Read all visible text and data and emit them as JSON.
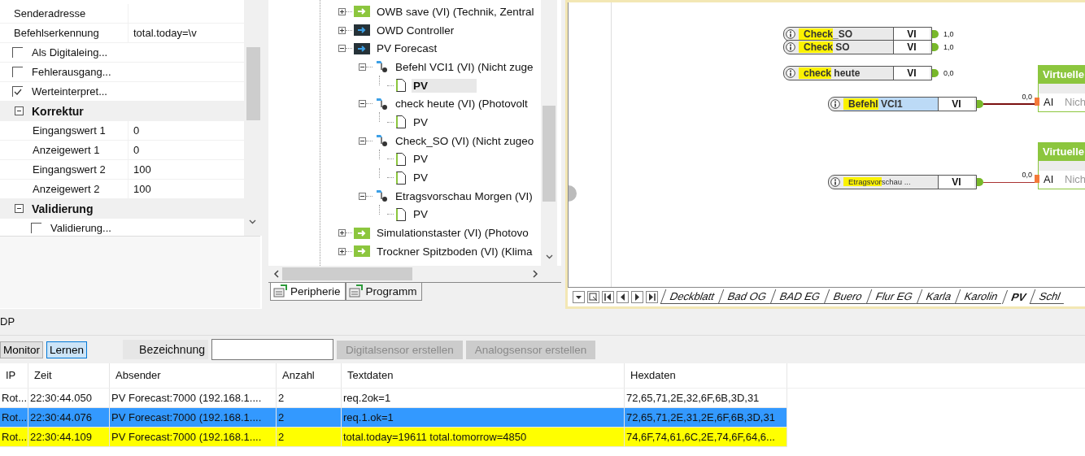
{
  "properties": [
    {
      "kind": "field",
      "name": "Senderadresse"
    },
    {
      "kind": "field",
      "name": "Befehlserkennung",
      "value": "total.today=\\v"
    },
    {
      "kind": "check",
      "name": "Als Digitaleing...",
      "checked": false
    },
    {
      "kind": "check",
      "name": "Fehlerausgang...",
      "checked": false
    },
    {
      "kind": "check",
      "name": "Werteinterpret...",
      "checked": true
    },
    {
      "kind": "category",
      "name": "Korrektur",
      "expanded": true
    },
    {
      "kind": "sub",
      "name": "Eingangswert 1",
      "value": "0"
    },
    {
      "kind": "sub",
      "name": "Anzeigewert 1",
      "value": "0"
    },
    {
      "kind": "sub",
      "name": "Eingangswert 2",
      "value": "100"
    },
    {
      "kind": "sub",
      "name": "Anzeigewert 2",
      "value": "100"
    },
    {
      "kind": "category",
      "name": "Validierung",
      "expanded": true
    },
    {
      "kind": "subcheck",
      "name": "Validierung...",
      "checked": false
    }
  ],
  "tree": [
    {
      "kind": "device",
      "label": "OWB save (VI) (Technik, Zentral",
      "color": "#8cc63e",
      "expanded": false,
      "selected": false
    },
    {
      "kind": "device",
      "label": "OWD Controller",
      "color": "#263238",
      "expanded": false,
      "selected": false
    },
    {
      "kind": "device",
      "label": "PV Forecast",
      "color": "#263238",
      "expanded": true,
      "selected": false,
      "children": [
        {
          "kind": "vi",
          "label": "Befehl VCI1 (VI) (Nicht zuge",
          "expanded": true,
          "selected": false,
          "children": [
            {
              "kind": "doc",
              "label": "PV",
              "selected": true
            }
          ]
        },
        {
          "kind": "vi",
          "label": "check heute (VI) (Photovolt",
          "expanded": true,
          "selected": false,
          "children": [
            {
              "kind": "doc",
              "label": "PV",
              "selected": false
            }
          ]
        },
        {
          "kind": "vi",
          "label": "Check_SO (VI) (Nicht zugeo",
          "expanded": true,
          "selected": false,
          "children": [
            {
              "kind": "doc",
              "label": "PV",
              "selected": false
            },
            {
              "kind": "doc",
              "label": "PV",
              "selected": false
            }
          ]
        },
        {
          "kind": "vi",
          "label": "Etragsvorschau Morgen (VI)",
          "expanded": true,
          "selected": false,
          "children": [
            {
              "kind": "doc",
              "label": "PV",
              "selected": false
            }
          ]
        }
      ]
    },
    {
      "kind": "device",
      "label": "Simulationstaster (VI) (Photovo",
      "color": "#8cc63e",
      "expanded": false,
      "selected": false
    },
    {
      "kind": "device",
      "label": "Trockner Spitzboden (VI) (Klima",
      "color": "#8cc63e",
      "expanded": false,
      "selected": false
    }
  ],
  "panel_tabs": [
    {
      "label": "Peripherie",
      "selected": true
    },
    {
      "label": "Programm",
      "selected": false
    }
  ],
  "canvas": {
    "nodes": [
      {
        "match": "Check",
        "rest": "_SO",
        "type": "VI",
        "value": "1,0",
        "selected": false,
        "small": false
      },
      {
        "match": "Check",
        "rest": " SO",
        "type": "VI",
        "value": "1,0",
        "selected": false,
        "small": false
      },
      {
        "match": "check",
        "rest": " heute",
        "type": "VI",
        "value": "0,0",
        "selected": false,
        "small": false
      },
      {
        "match": "Befehl",
        "rest": " VCI1",
        "type": "VI",
        "value": "0,0",
        "selected": true,
        "small": false,
        "linked": true
      },
      {
        "match": "Etragsvor",
        "rest": "schau ...",
        "type": "VI",
        "value": "0,0",
        "selected": false,
        "small": true,
        "linked": true
      }
    ],
    "blocks": [
      {
        "title": "Virtuelle",
        "port": "AI",
        "label": "Nich"
      },
      {
        "title": "Virtuelle",
        "port": "AI",
        "label": "Nich"
      }
    ]
  },
  "sheet_tabs": [
    {
      "label": "Deckblatt",
      "selected": false
    },
    {
      "label": "Bad OG",
      "selected": false
    },
    {
      "label": "BAD EG",
      "selected": false
    },
    {
      "label": "Buero",
      "selected": false
    },
    {
      "label": "Flur EG",
      "selected": false
    },
    {
      "label": "Karla",
      "selected": false
    },
    {
      "label": "Karolin",
      "selected": false
    },
    {
      "label": "PV",
      "selected": true
    },
    {
      "label": "Schl",
      "selected": false
    }
  ],
  "udp": {
    "title": "DP",
    "modes": [
      {
        "label": "Monitor",
        "selected": false
      },
      {
        "label": "Lernen",
        "selected": true
      }
    ],
    "name_label": "Bezeichnung",
    "actions": [
      {
        "label": "Digitalsensor erstellen",
        "disabled": true
      },
      {
        "label": "Analogsensor erstellen",
        "disabled": true
      }
    ],
    "columns": [
      "IP",
      "Zeit",
      "Absender",
      "Anzahl",
      "Textdaten",
      "Hexdaten"
    ],
    "rows": [
      {
        "cells": [
          "Rot...",
          "22:30:44.050",
          "PV Forecast:7000 (192.168.1....",
          "2",
          "req.2ok=1",
          "72,65,71,2E,32,6F,6B,3D,31"
        ],
        "selected": false,
        "highlighted": false
      },
      {
        "cells": [
          "Rot...",
          "22:30:44.076",
          "PV Forecast:7000 (192.168.1....",
          "2",
          "req.1.ok=1",
          "72,65,71,2E,31,2E,6F,6B,3D,31"
        ],
        "selected": true,
        "highlighted": false
      },
      {
        "cells": [
          "Rot...",
          "22:30:44.109",
          "PV Forecast:7000 (192.168.1....",
          "2",
          "total.today=19611 total.tomorrow=4850",
          "74,6F,74,61,6C,2E,74,6F,64,6..."
        ],
        "selected": false,
        "highlighted": true
      }
    ]
  }
}
